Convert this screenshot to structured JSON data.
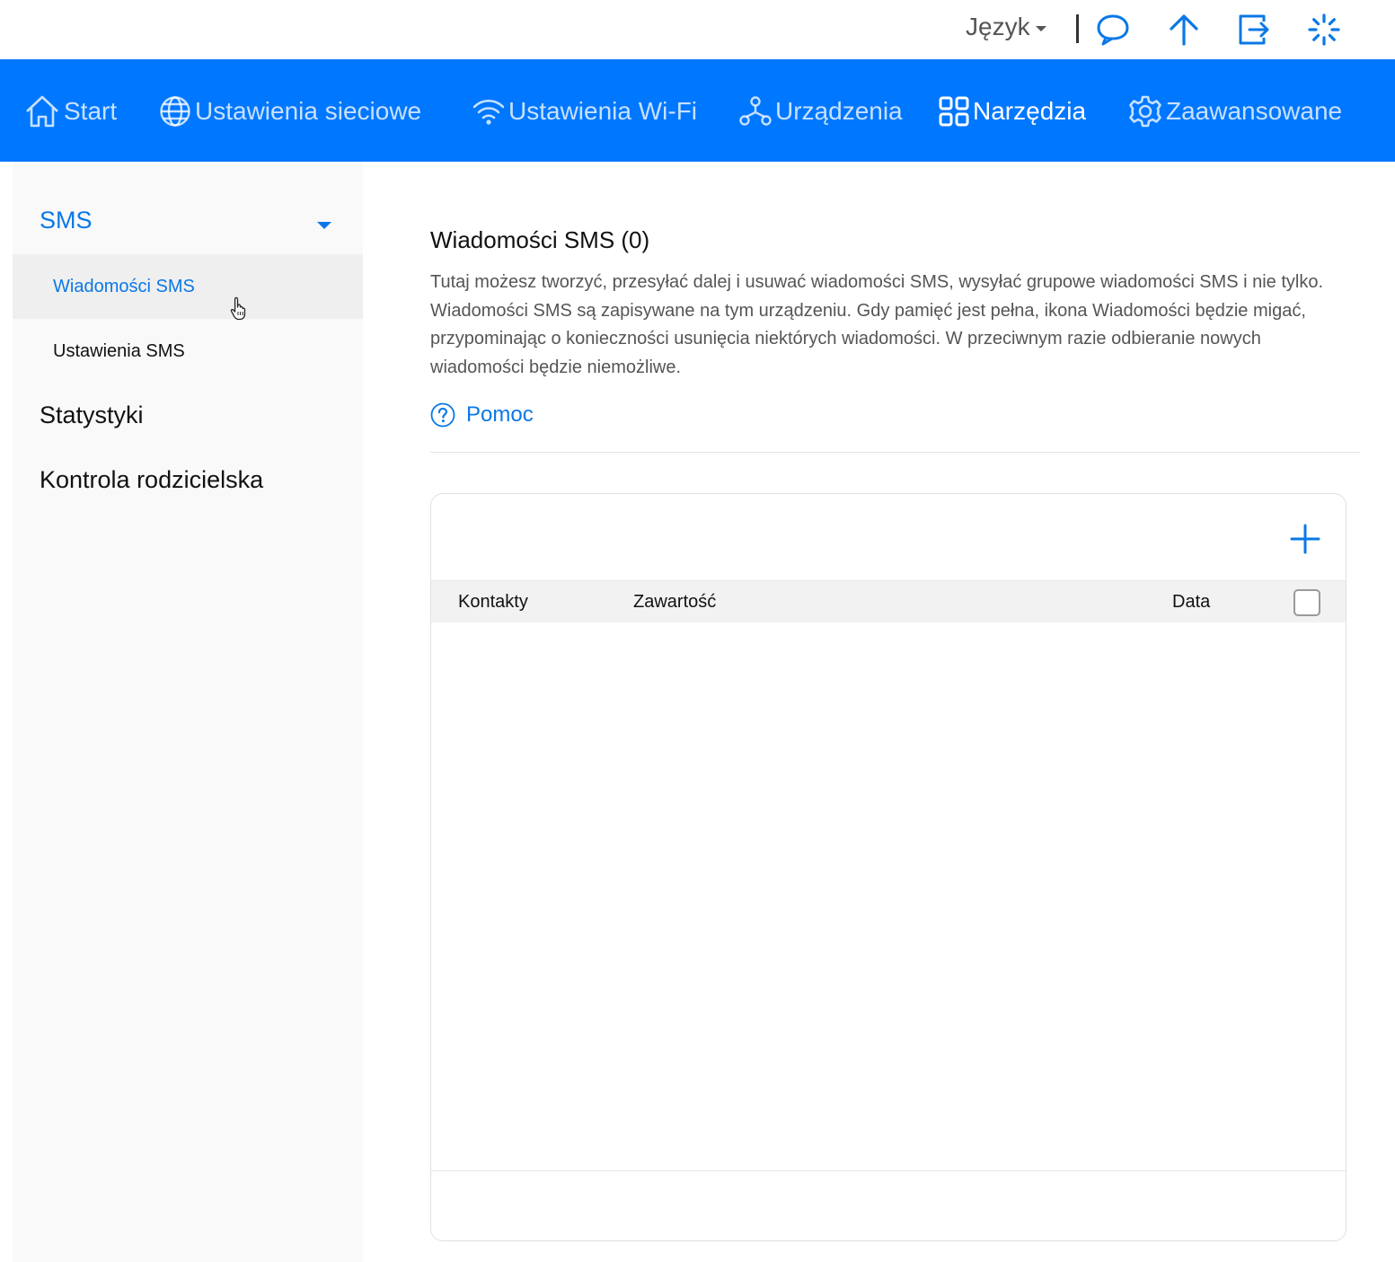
{
  "header": {
    "language_label": "Język",
    "icons": [
      "chat-bubble-icon",
      "upload-arrow-icon",
      "logout-icon",
      "loading-spinner-icon"
    ]
  },
  "nav": {
    "items": [
      {
        "label": "Start",
        "icon": "home-icon",
        "active": false
      },
      {
        "label": "Ustawienia sieciowe",
        "icon": "globe-icon",
        "active": false
      },
      {
        "label": "Ustawienia Wi-Fi",
        "icon": "wifi-icon",
        "active": false
      },
      {
        "label": "Urządzenia",
        "icon": "devices-icon",
        "active": false
      },
      {
        "label": "Narzędzia",
        "icon": "grid-icon",
        "active": true
      },
      {
        "label": "Zaawansowane",
        "icon": "gear-icon",
        "active": false
      }
    ]
  },
  "sidebar": {
    "groups": [
      {
        "label": "SMS",
        "expanded": true,
        "items": [
          {
            "label": "Wiadomości SMS",
            "active": true
          },
          {
            "label": "Ustawienia SMS",
            "active": false
          }
        ]
      },
      {
        "label": "Statystyki"
      },
      {
        "label": "Kontrola rodzicielska"
      }
    ]
  },
  "main": {
    "title": "Wiadomości SMS (0)",
    "description": "Tutaj możesz tworzyć, przesyłać dalej i usuwać wiadomości SMS, wysyłać grupowe wiadomości SMS i nie tylko. Wiadomości SMS są zapisywane na tym urządzeniu. Gdy pamięć jest pełna, ikona Wiadomości będzie migać, przypominając o konieczności usunięcia niektórych wiadomości. W przeciwnym razie odbieranie nowych wiadomości będzie niemożliwe.",
    "help_label": "Pomoc",
    "table": {
      "columns": [
        "Kontakty",
        "Zawartość",
        "Data"
      ],
      "rows": []
    }
  },
  "colors": {
    "brand_blue": "#0077ff",
    "link_blue": "#0a78e6"
  }
}
